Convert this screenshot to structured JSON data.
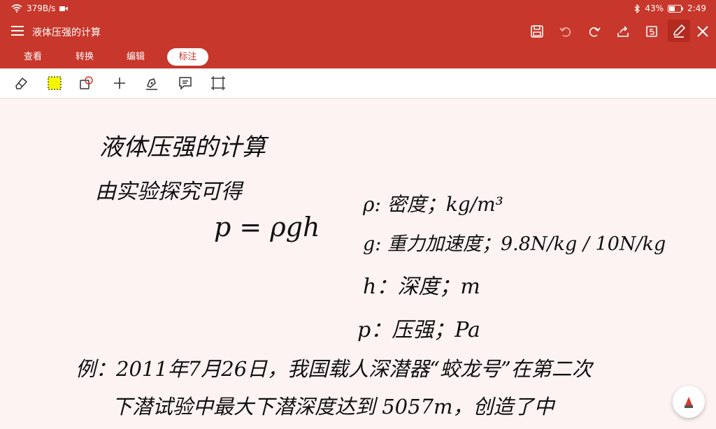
{
  "status": {
    "speed": "379B/s",
    "battery": "43%",
    "time": "2:49"
  },
  "header": {
    "title": "液体压强的计算"
  },
  "tabs": [
    {
      "label": "查看"
    },
    {
      "label": "转换"
    },
    {
      "label": "编辑"
    },
    {
      "label": "标注"
    }
  ],
  "note": {
    "title": "液体压强的计算",
    "subtitle": "由实验探究可得",
    "formula": "p = ρgh",
    "def_rho": "ρ: 密度；kg/m³",
    "def_g": "g: 重力加速度；9.8N/kg / 10N/kg",
    "def_h": "h：深度；m",
    "def_p": "p：压强；Pa",
    "example_line1": "例：2011年7月26日，我国载人深潜器“蛟龙号”在第二次",
    "example_line2": "下潜试验中最大下潜深度达到 5057m，创造了中"
  },
  "colors": {
    "brand": "#c7372b",
    "paper": "#fdf3f3"
  }
}
